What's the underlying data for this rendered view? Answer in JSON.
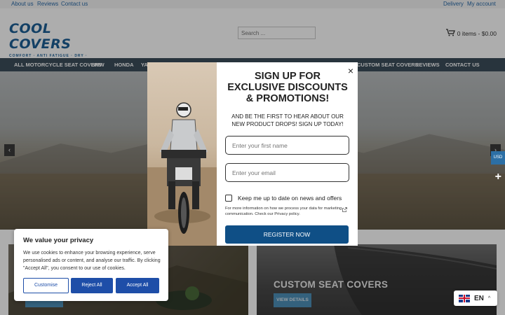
{
  "topbar": {
    "links": [
      "About us",
      "Reviews",
      "Contact us"
    ],
    "right_links": [
      "Delivery",
      "My account"
    ]
  },
  "header": {
    "logo_text": "COOL COVERS",
    "logo_tagline": "COMFORT · ANTI FATIGUE · DRY · COOLNESS",
    "search_placeholder": "Search ...",
    "cart_text": "0 items - $0.00"
  },
  "nav": {
    "items": [
      "ALL MOTORCYCLE SEAT COVERS",
      "BMW",
      "HONDA",
      "YA",
      "CUSTOM SEAT COVERS",
      "REVIEWS",
      "CONTACT US"
    ]
  },
  "hero": {
    "prev": "‹",
    "next": "›"
  },
  "cards": [
    {
      "title": "",
      "button": "VIEW DETAILS"
    },
    {
      "title": "CUSTOM SEAT COVERS",
      "button": "VIEW DETAILS"
    }
  ],
  "side": {
    "currency": "USD",
    "plus": "+"
  },
  "modal": {
    "title": "SIGN UP FOR EXCLUSIVE DISCOUNTS & PROMOTIONS!",
    "subtitle": "AND BE THE FIRST TO HEAR ABOUT OUR NEW PRODUCT DROPS! SIGN UP TODAY!",
    "first_name_placeholder": "Enter your first name",
    "email_placeholder": "Enter your email",
    "checkbox_label": "Keep me up to date on news and offers",
    "info_text": "For more information on how we process your data for marketing communication. Check our Privacy policy.",
    "register_label": "REGISTER NOW",
    "close": "×"
  },
  "cookie": {
    "title": "We value your privacy",
    "text": "We use cookies to enhance your browsing experience, serve personalised ads or content, and analyse our traffic. By clicking \"Accept All\", you consent to our use of cookies.",
    "customise": "Customise",
    "reject": "Reject All",
    "accept": "Accept All"
  },
  "language": {
    "code": "EN",
    "chevron": "^"
  },
  "colors": {
    "brand": "#1d5f96",
    "nav_bg": "#3c4d5b",
    "register_bg": "#0f4f86",
    "cookie_btn": "#1e4ea8"
  }
}
